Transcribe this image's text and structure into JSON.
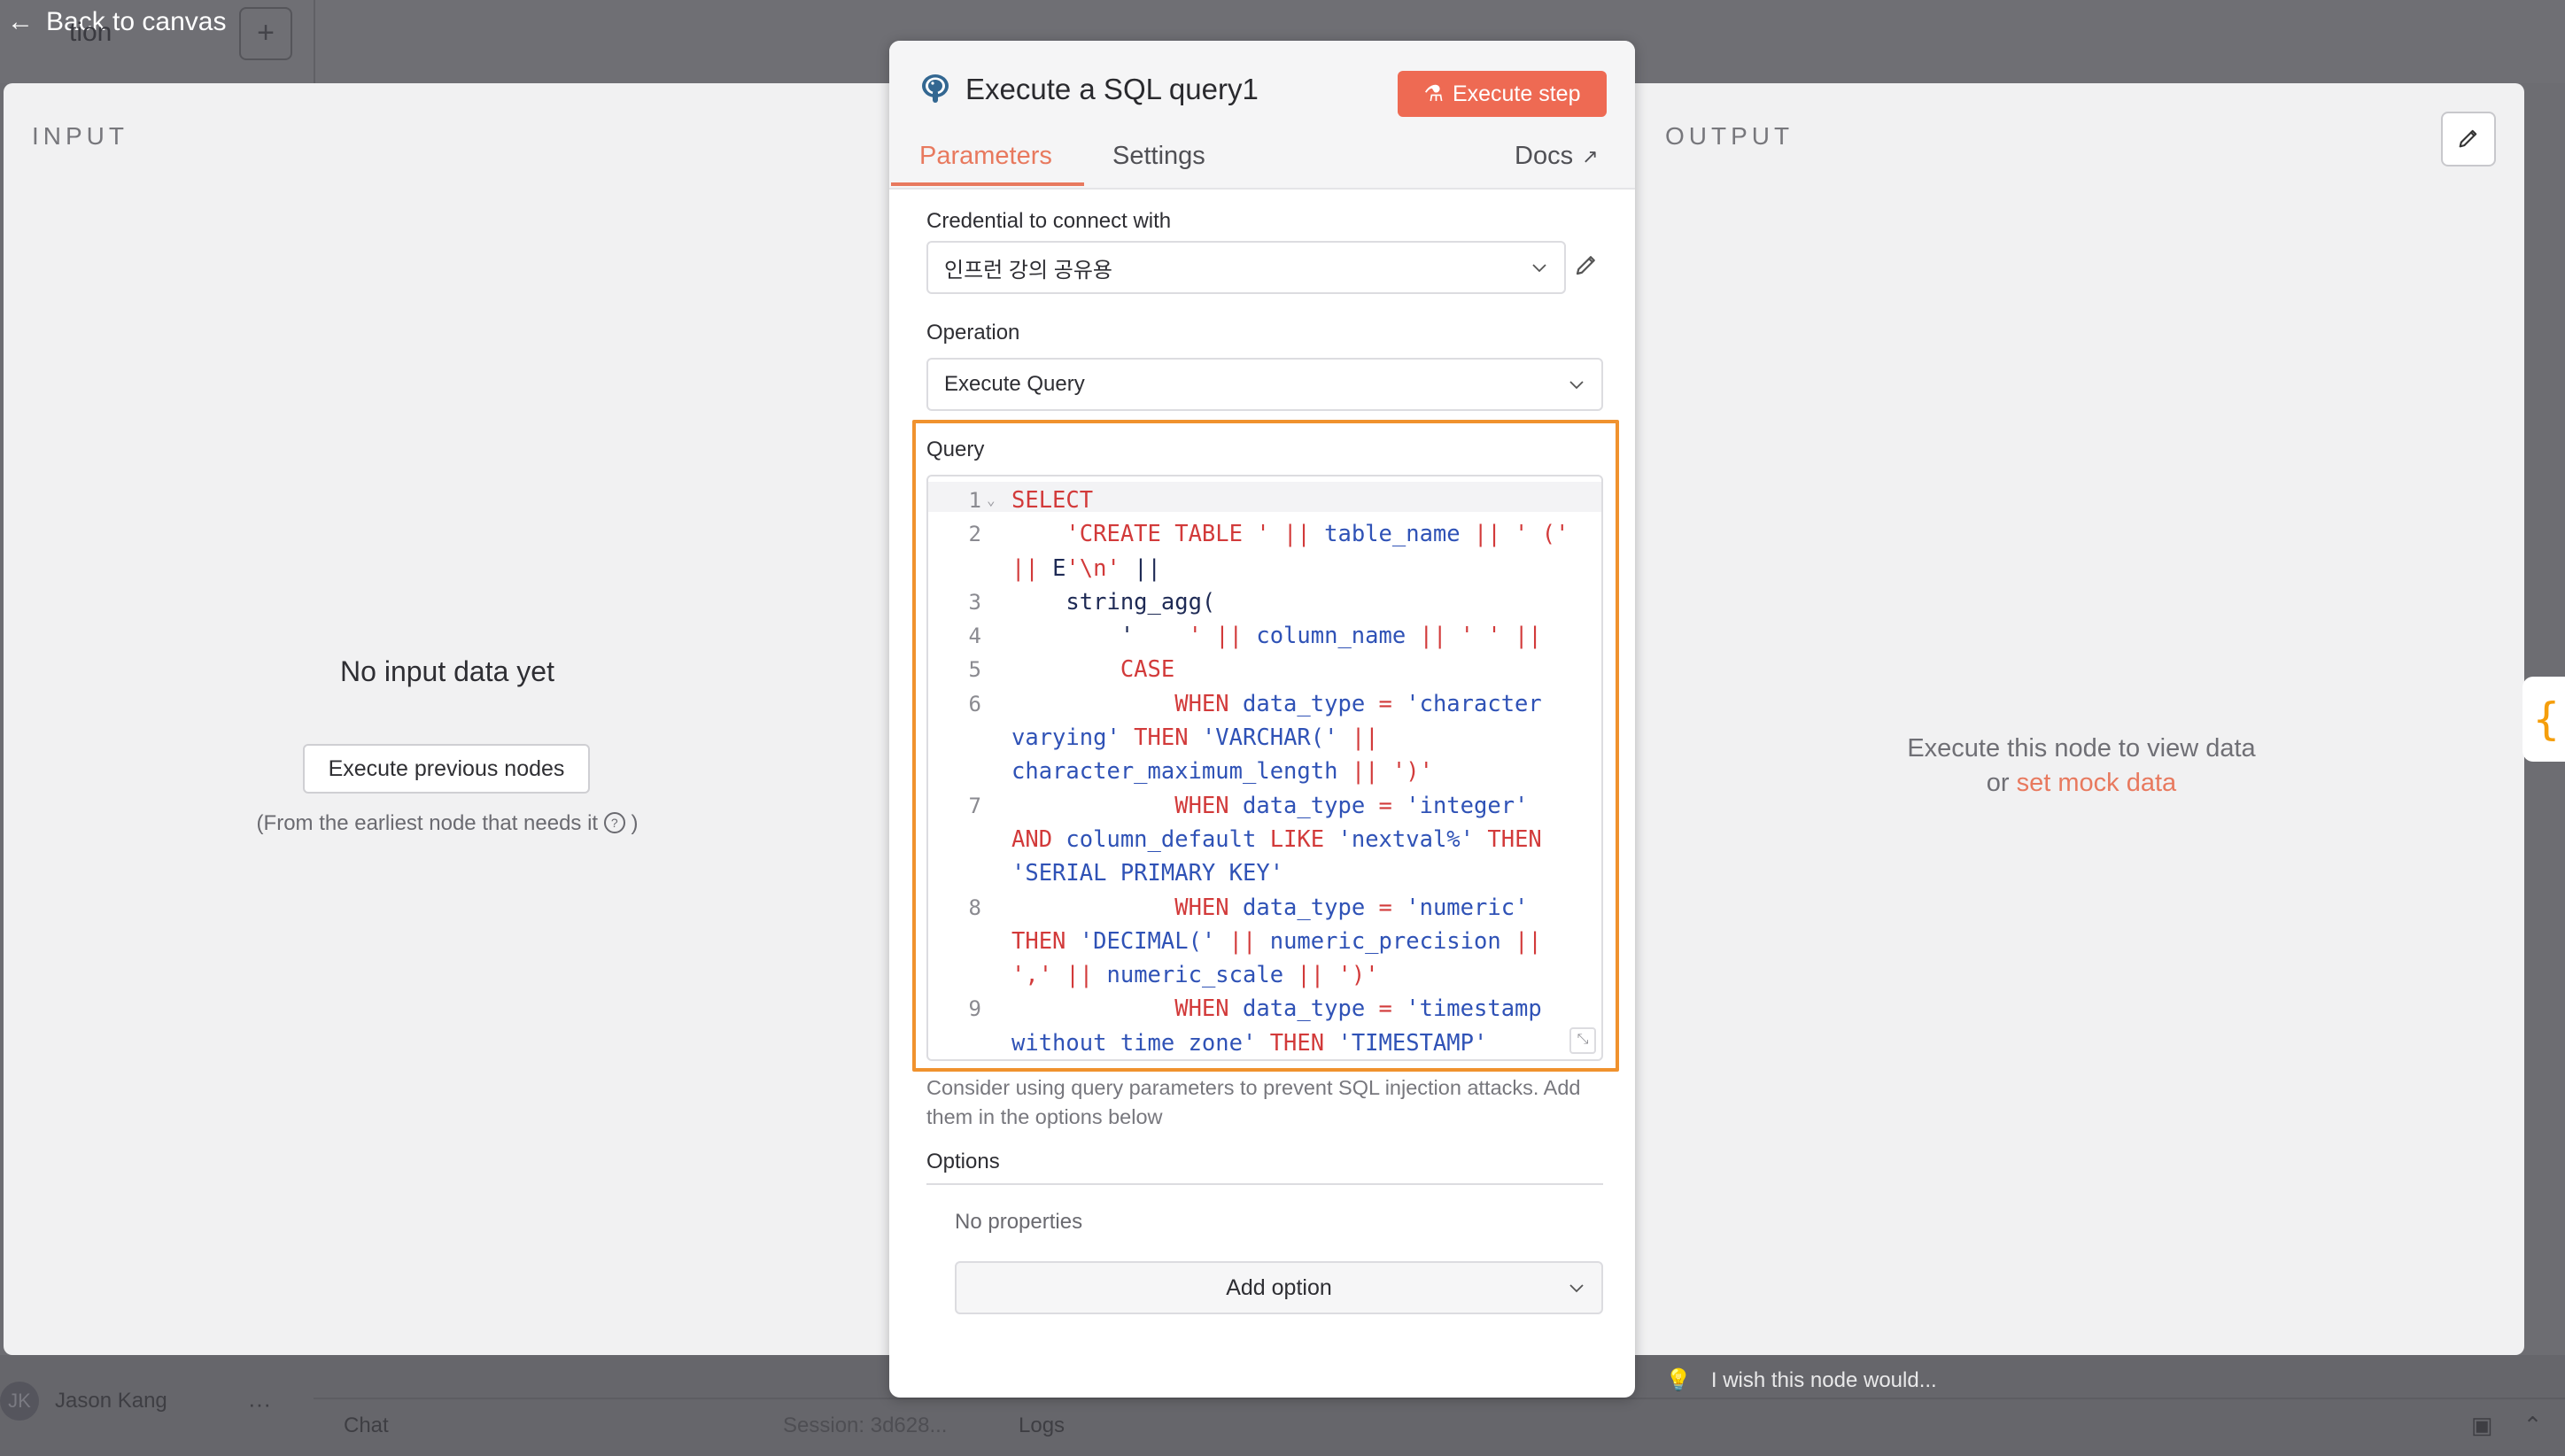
{
  "background": {
    "back_label": "Back to canvas",
    "workflow_name_fragment": "tion",
    "add_label": "+",
    "user_initials": "JK",
    "user_name": "Jason Kang",
    "user_menu": "···",
    "chat_label": "Chat",
    "session_label": "Session: 3d628...",
    "logs_label": "Logs"
  },
  "input_panel": {
    "title": "INPUT",
    "empty_title": "No input data yet",
    "execute_previous_label": "Execute previous nodes",
    "from_note": "(From the earliest node that needs it",
    "from_note_end": ")"
  },
  "output_panel": {
    "title": "OUTPUT",
    "execute_hint": "Execute this node to view data",
    "or_text": "or",
    "mock_link": "set mock data"
  },
  "node": {
    "title": "Execute a SQL query1",
    "execute_step_label": "Execute step",
    "tabs": [
      {
        "label": "Parameters",
        "active": true
      },
      {
        "label": "Settings",
        "active": false
      }
    ],
    "docs_label": "Docs",
    "credential_label": "Credential to connect with",
    "credential_value": "인프런 강의 공유용",
    "operation_label": "Operation",
    "operation_value": "Execute Query",
    "query_label": "Query",
    "query_lines": [
      {
        "n": "1",
        "fold": "⌄",
        "rows": [
          [
            [
              "k",
              "SELECT"
            ]
          ]
        ]
      },
      {
        "n": "2",
        "rows": [
          [
            [
              "k",
              "    'CREATE TABLE ' || "
            ],
            [
              "id",
              "table_name"
            ],
            [
              "k",
              " || ' ('"
            ]
          ],
          [
            [
              "k",
              "|| "
            ],
            [
              "fn",
              "E"
            ],
            [
              "k",
              "'\\n' "
            ],
            [
              "fn",
              "||"
            ]
          ]
        ]
      },
      {
        "n": "3",
        "rows": [
          [
            [
              "fn",
              "    string_agg("
            ]
          ]
        ]
      },
      {
        "n": "4",
        "rows": [
          [
            [
              "fn",
              "        '"
            ],
            [
              "k",
              "    ' || "
            ],
            [
              "id",
              "column_name"
            ],
            [
              "k",
              " || ' ' ||"
            ]
          ]
        ]
      },
      {
        "n": "5",
        "rows": [
          [
            [
              "k",
              "        CASE"
            ]
          ]
        ]
      },
      {
        "n": "6",
        "rows": [
          [
            [
              "k",
              "            WHEN "
            ],
            [
              "id",
              "data_type"
            ],
            [
              "k",
              " = "
            ],
            [
              "id",
              "'character"
            ]
          ],
          [
            [
              "id",
              "varying'"
            ],
            [
              "k",
              " THEN "
            ],
            [
              "id",
              "'VARCHAR('"
            ],
            [
              "k",
              " ||"
            ]
          ],
          [
            [
              "id",
              "character_maximum_length"
            ],
            [
              "k",
              " || ')'"
            ]
          ]
        ]
      },
      {
        "n": "7",
        "rows": [
          [
            [
              "k",
              "            WHEN "
            ],
            [
              "id",
              "data_type"
            ],
            [
              "k",
              " = "
            ],
            [
              "id",
              "'integer'"
            ]
          ],
          [
            [
              "k",
              "AND "
            ],
            [
              "id",
              "column_default"
            ],
            [
              "k",
              " LIKE "
            ],
            [
              "id",
              "'nextval%'"
            ],
            [
              "k",
              " THEN"
            ]
          ],
          [
            [
              "id",
              "'SERIAL PRIMARY KEY'"
            ]
          ]
        ]
      },
      {
        "n": "8",
        "rows": [
          [
            [
              "k",
              "            WHEN "
            ],
            [
              "id",
              "data_type"
            ],
            [
              "k",
              " = "
            ],
            [
              "id",
              "'numeric'"
            ]
          ],
          [
            [
              "k",
              "THEN "
            ],
            [
              "id",
              "'DECIMAL('"
            ],
            [
              "k",
              " || "
            ],
            [
              "id",
              "numeric_precision"
            ],
            [
              "k",
              " ||"
            ]
          ],
          [
            [
              "k",
              "','"
            ],
            [
              "k",
              " || "
            ],
            [
              "id",
              "numeric_scale"
            ],
            [
              "k",
              " || ')'"
            ]
          ]
        ]
      },
      {
        "n": "9",
        "rows": [
          [
            [
              "k",
              "            WHEN "
            ],
            [
              "id",
              "data_type"
            ],
            [
              "k",
              " = "
            ],
            [
              "id",
              "'timestamp"
            ]
          ],
          [
            [
              "id",
              "without time zone'"
            ],
            [
              "k",
              " THEN "
            ],
            [
              "id",
              "'TIMESTAMP'"
            ]
          ]
        ]
      }
    ],
    "query_hint": "Consider using query parameters to prevent SQL injection attacks. Add them in the options below",
    "options_label": "Options",
    "no_properties": "No properties",
    "add_option_label": "Add option",
    "feedback_label": "I wish this node would..."
  },
  "colors": {
    "accent": "#e8795e",
    "execute_button": "#ee6a53",
    "highlight_frame": "#f0922e",
    "sql_keyword": "#d23a3a",
    "sql_identifier": "#2f52b6"
  }
}
